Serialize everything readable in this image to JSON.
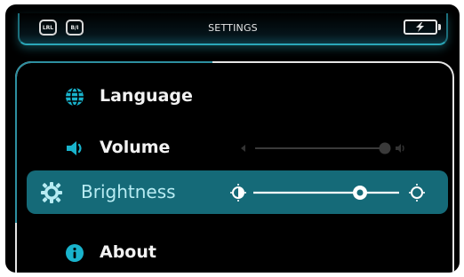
{
  "header": {
    "title": "SETTINGS",
    "left_icons": [
      {
        "label": "LRL",
        "icon": "lrl-icon"
      },
      {
        "label": "B/I",
        "icon": "bi-icon"
      }
    ],
    "battery_icon": "battery-charging-icon"
  },
  "menu": {
    "items": [
      {
        "label": "Language",
        "icon": "globe-icon"
      },
      {
        "label": "Volume",
        "icon": "speaker-icon",
        "slider_level": 0.93
      },
      {
        "label": "Brightness",
        "icon": "sun-icon",
        "slider_level": 0.75,
        "selected": true
      },
      {
        "label": "About",
        "icon": "info-icon"
      }
    ]
  },
  "colors": {
    "accent": "#2aa7b8",
    "selected_row": "#156a78",
    "icon_accent": "#19b3cc",
    "background": "#000000"
  }
}
